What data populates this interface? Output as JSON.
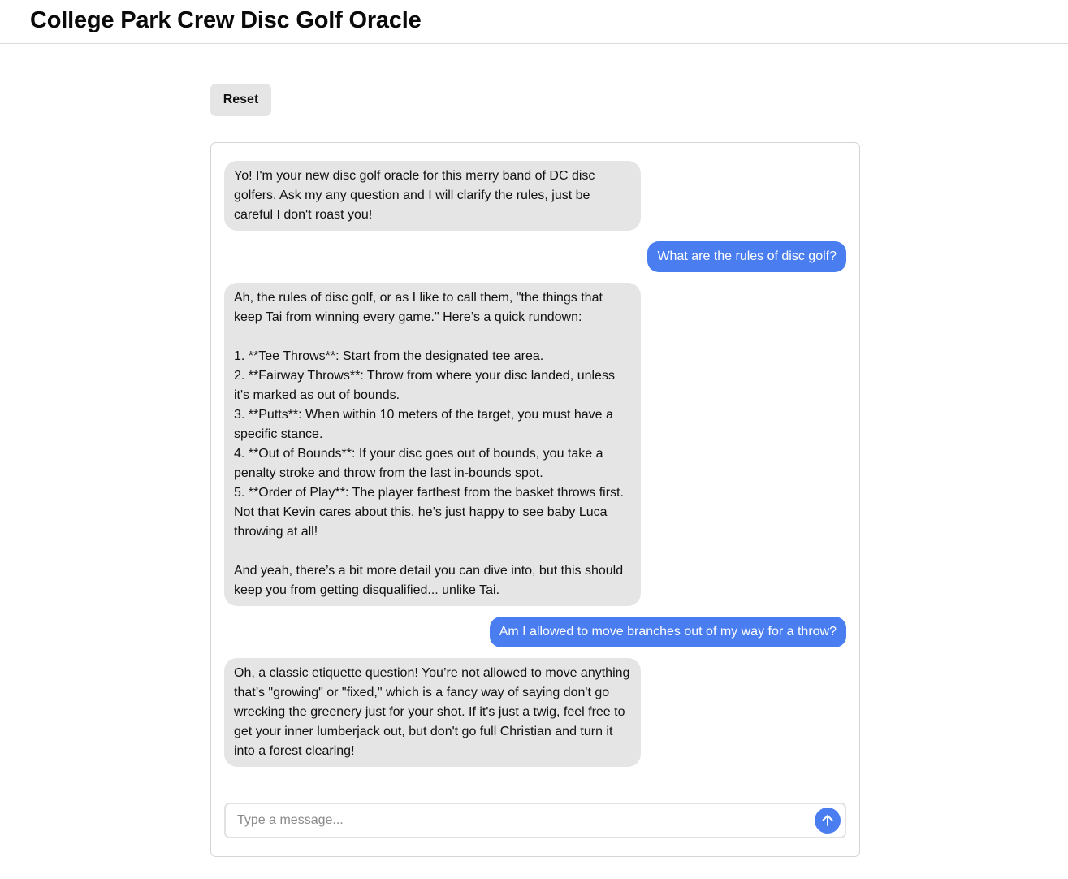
{
  "header": {
    "title": "College Park Crew Disc Golf Oracle"
  },
  "toolbar": {
    "reset_label": "Reset"
  },
  "chat": {
    "messages": [
      {
        "role": "bot",
        "text": "Yo! I'm your new disc golf oracle for this merry band of DC disc golfers. Ask my any question and I will clarify the rules, just be careful I don't roast you!"
      },
      {
        "role": "user",
        "text": "What are the rules of disc golf?"
      },
      {
        "role": "bot",
        "text": "Ah, the rules of disc golf, or as I like to call them, \"the things that keep Tai from winning every game.\" Here’s a quick rundown:\n\n1. **Tee Throws**: Start from the designated tee area.\n2. **Fairway Throws**: Throw from where your disc landed, unless it's marked as out of bounds.\n3. **Putts**: When within 10 meters of the target, you must have a specific stance.\n4. **Out of Bounds**: If your disc goes out of bounds, you take a penalty stroke and throw from the last in-bounds spot.\n5. **Order of Play**: The player farthest from the basket throws first. Not that Kevin cares about this, he’s just happy to see baby Luca throwing at all!\n\nAnd yeah, there’s a bit more detail you can dive into, but this should keep you from getting disqualified... unlike Tai."
      },
      {
        "role": "user",
        "text": "Am I allowed to move branches out of my way for a throw?"
      },
      {
        "role": "bot",
        "text": "Oh, a classic etiquette question! You’re not allowed to move anything that’s \"growing\" or \"fixed,\" which is a fancy way of saying don't go wrecking the greenery just for your shot. If it's just a twig, feel free to get your inner lumberjack out, but don't go full Christian and turn it into a forest clearing!"
      }
    ]
  },
  "composer": {
    "placeholder": "Type a message...",
    "value": "",
    "send_icon": "arrow-up-icon"
  },
  "colors": {
    "accent": "#4a7ef0",
    "bot_bubble": "#e5e5e5",
    "user_text": "#ffffff"
  }
}
